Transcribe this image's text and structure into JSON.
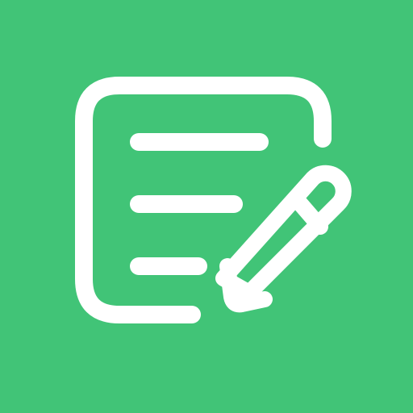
{
  "icon": {
    "name": "notes-edit-icon",
    "description_name": "note-with-pencil-icon"
  },
  "colors": {
    "background": "#41C477",
    "foreground": "#FFFFFF"
  }
}
